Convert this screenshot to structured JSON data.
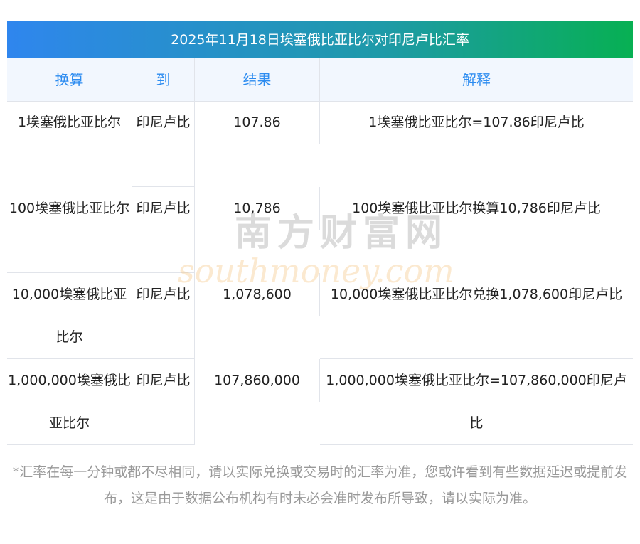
{
  "title": "2025年11月18日埃塞俄比亚比尔对印尼卢比汇率",
  "headers": [
    "换算",
    "到",
    "结果",
    "解释"
  ],
  "rows": [
    {
      "from": "1埃塞俄比亚比尔",
      "to": "印尼卢比",
      "result": "107.86",
      "explain": "1埃塞俄比亚比尔=107.86印尼卢比"
    },
    {
      "from": "100埃塞俄比亚比尔",
      "to": "印尼卢比",
      "result": "10,786",
      "explain": "100埃塞俄比亚比尔换算10,786印尼卢比"
    },
    {
      "from": "10,000埃塞俄比亚比尔",
      "to": "印尼卢比",
      "result": "1,078,600",
      "explain": "10,000埃塞俄比亚比尔兑换1,078,600印尼卢比"
    },
    {
      "from": "1,000,000埃塞俄比亚比尔",
      "to": "印尼卢比",
      "result": "107,860,000",
      "explain": "1,000,000埃塞俄比亚比尔=107,860,000印尼卢比"
    }
  ],
  "note": "*汇率在每一分钟或都不尽相同，请以实际兑换或交易时的汇率为准，您或许看到有些数据延迟或提前发布，这是由于数据公布机构有时未必会准时发布所导致，请以实际为准。",
  "watermark": {
    "cn": "南方财富网",
    "en": "southmoney.com"
  }
}
